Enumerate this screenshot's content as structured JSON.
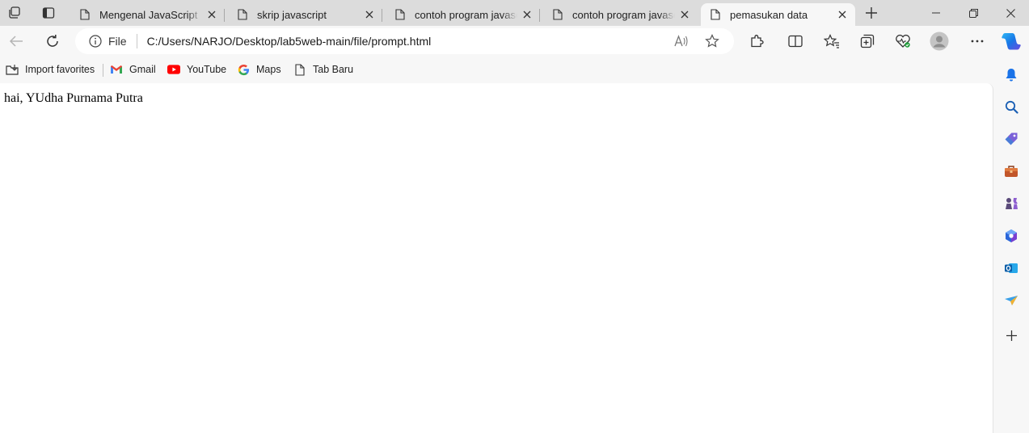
{
  "tabs": [
    {
      "title": "Mengenal JavaScript",
      "active": false
    },
    {
      "title": "skrip javascript",
      "active": false
    },
    {
      "title": "contoh program javascript",
      "active": false
    },
    {
      "title": "contoh program javascript",
      "active": false
    },
    {
      "title": "pemasukan data",
      "active": true
    }
  ],
  "address": {
    "scheme": "File",
    "url": "C:/Users/NARJO/Desktop/lab5web-main/file/prompt.html"
  },
  "favorites": [
    {
      "label": "Import favorites",
      "icon": "import-icon"
    },
    {
      "label": "Gmail",
      "icon": "gmail-icon"
    },
    {
      "label": "YouTube",
      "icon": "youtube-icon"
    },
    {
      "label": "Maps",
      "icon": "google-icon"
    },
    {
      "label": "Tab Baru",
      "icon": "page-icon"
    }
  ],
  "page": {
    "text": "hai, YUdha Purnama Putra"
  },
  "colors": {
    "tabstrip": "#dcdcdc",
    "toolbar": "#f7f7f7",
    "accent": "#0f6cbd"
  }
}
